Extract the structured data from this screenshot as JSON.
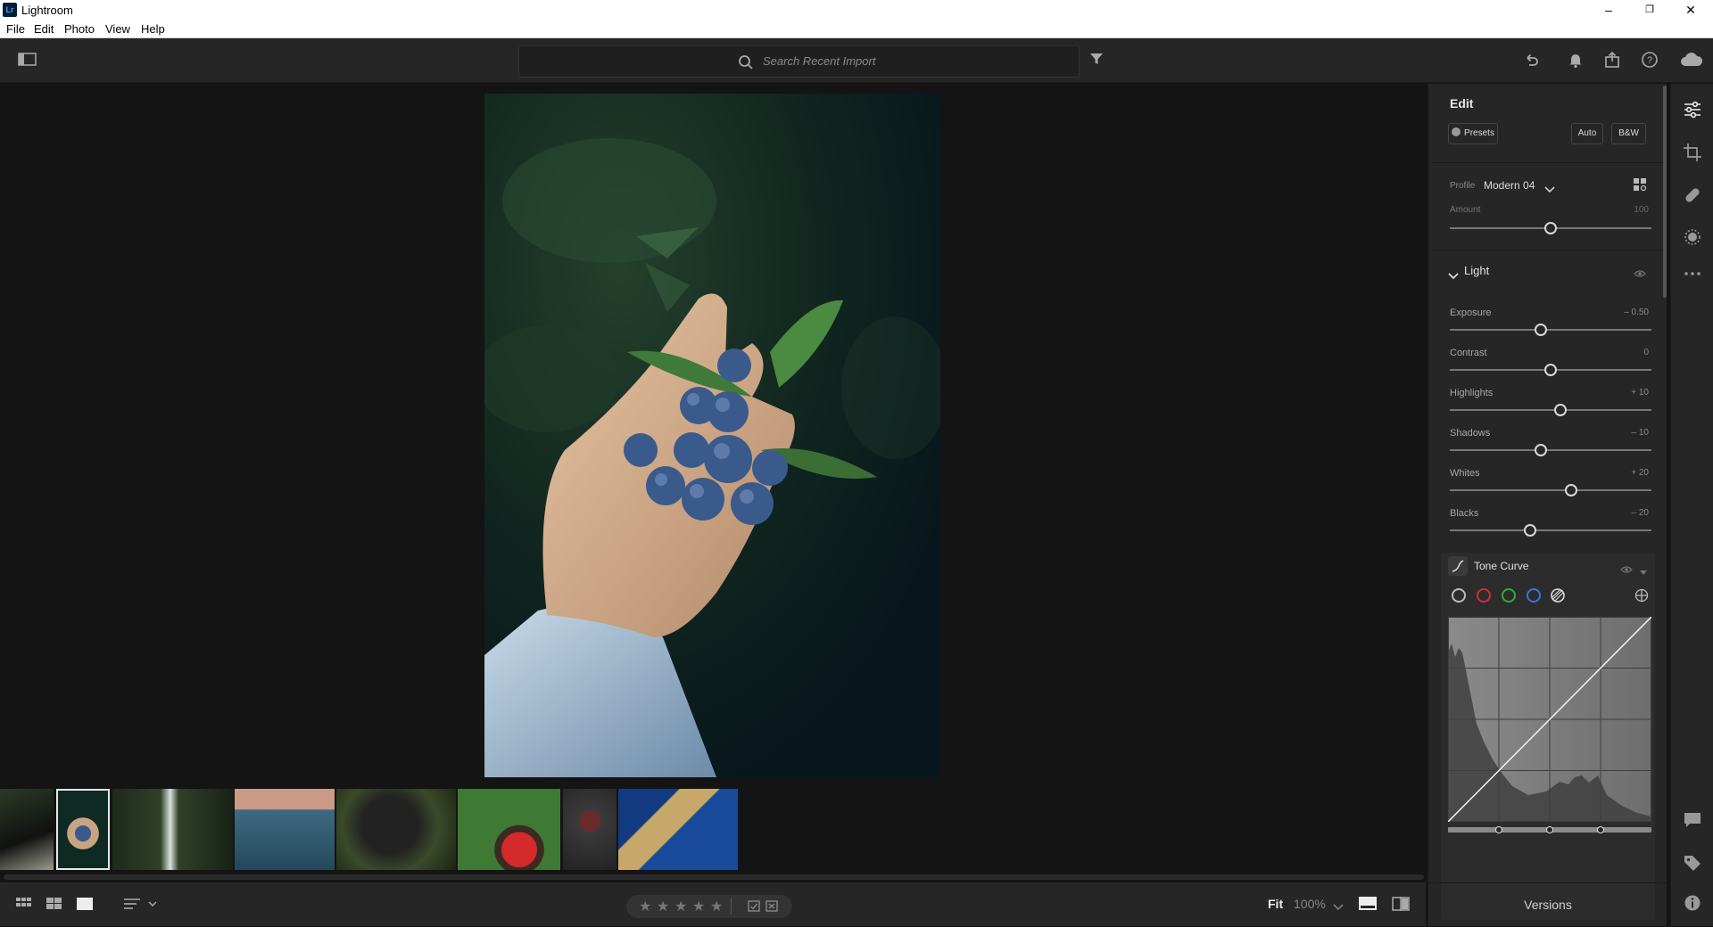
{
  "window": {
    "logo": "Lr",
    "title": "Lightroom",
    "minimize": "–",
    "maximize": "❐",
    "close": "✕"
  },
  "menu": [
    "File",
    "Edit",
    "Photo",
    "View",
    "Help"
  ],
  "toolbar": {
    "search_placeholder": "Search Recent Import",
    "icons": [
      "panel-toggle-icon",
      "search-icon",
      "filter-icon",
      "undo-icon",
      "bell-icon",
      "share-icon",
      "help-icon",
      "cloud-icon"
    ]
  },
  "filmstrip": {
    "thumbnails": [
      "bird",
      "blueberries-hand",
      "waterfall",
      "ocean-jump",
      "gorilla",
      "woman-red-dress",
      "cake",
      "greek-columns"
    ],
    "selected_index": 1
  },
  "bottombar": {
    "stars": [
      "★",
      "★",
      "★",
      "★",
      "★"
    ],
    "fit": "Fit",
    "zoom": "100%",
    "icons": [
      "grid-small-icon",
      "grid-large-icon",
      "single-view-icon",
      "sort-icon",
      "flag-pick-icon",
      "flag-reject-icon",
      "filmstrip-toggle-icon",
      "compare-icon"
    ]
  },
  "edit_panel": {
    "title": "Edit",
    "presets_label": "Presets",
    "auto_label": "Auto",
    "bw_label": "B&W",
    "profile_label": "Profile",
    "profile_value": "Modern 04",
    "amount_label": "Amount",
    "amount_value": "100",
    "amount_position": 0.5,
    "light_section": "Light",
    "sliders": [
      {
        "label": "Exposure",
        "value": "– 0.50",
        "position": 0.45
      },
      {
        "label": "Contrast",
        "value": "0",
        "position": 0.5
      },
      {
        "label": "Highlights",
        "value": "+ 10",
        "position": 0.55
      },
      {
        "label": "Shadows",
        "value": "– 10",
        "position": 0.45
      },
      {
        "label": "Whites",
        "value": "+ 20",
        "position": 0.6
      },
      {
        "label": "Blacks",
        "value": "– 20",
        "position": 0.4
      }
    ],
    "tone_curve_title": "Tone Curve",
    "tone_curve_channels": [
      {
        "name": "point-curve",
        "color": "#bdbdbd"
      },
      {
        "name": "red",
        "color": "#d12f2f"
      },
      {
        "name": "green",
        "color": "#2faa3a"
      },
      {
        "name": "blue",
        "color": "#3b74d6"
      }
    ],
    "versions_label": "Versions"
  },
  "colors": {
    "panel": "#262626",
    "canvas": "#141414",
    "accent": "#e8e8e8"
  }
}
